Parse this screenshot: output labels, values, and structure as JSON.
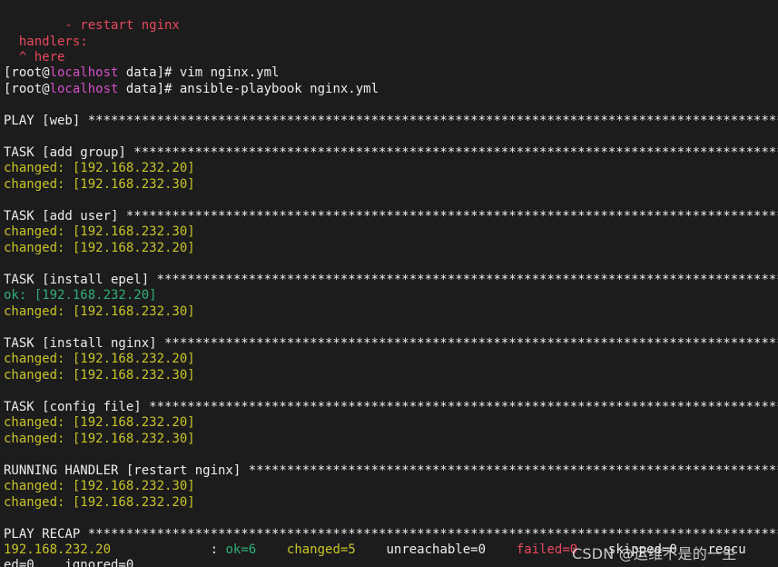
{
  "terminal": {
    "error": {
      "restart_line": "        - restart nginx",
      "handlers_line": "  handlers:",
      "here_line": "  ^ here"
    },
    "prompt": {
      "open": "[root@",
      "host": "localhost",
      "dir_close": " data]# "
    },
    "commands": [
      "vim nginx.yml",
      "ansible-playbook nginx.yml"
    ],
    "play_header": "PLAY [web] ********************************************************************************************",
    "tasks": [
      {
        "header": "TASK [add group] **************************************************************************************",
        "results": [
          {
            "status": "changed",
            "text": "changed: [192.168.232.20]"
          },
          {
            "status": "changed",
            "text": "changed: [192.168.232.30]"
          }
        ]
      },
      {
        "header": "TASK [add user] ***************************************************************************************",
        "results": [
          {
            "status": "changed",
            "text": "changed: [192.168.232.30]"
          },
          {
            "status": "changed",
            "text": "changed: [192.168.232.20]"
          }
        ]
      },
      {
        "header": "TASK [install epel] ***********************************************************************************",
        "results": [
          {
            "status": "ok",
            "text": "ok: [192.168.232.20]"
          },
          {
            "status": "changed",
            "text": "changed: [192.168.232.30]"
          }
        ]
      },
      {
        "header": "TASK [install nginx] **********************************************************************************",
        "results": [
          {
            "status": "changed",
            "text": "changed: [192.168.232.20]"
          },
          {
            "status": "changed",
            "text": "changed: [192.168.232.30]"
          }
        ]
      },
      {
        "header": "TASK [config file] ************************************************************************************",
        "results": [
          {
            "status": "changed",
            "text": "changed: [192.168.232.20]"
          },
          {
            "status": "changed",
            "text": "changed: [192.168.232.30]"
          }
        ]
      },
      {
        "header": "RUNNING HANDLER [restart nginx] ***********************************************************************",
        "results": [
          {
            "status": "changed",
            "text": "changed: [192.168.232.30]"
          },
          {
            "status": "changed",
            "text": "changed: [192.168.232.20]"
          }
        ]
      }
    ],
    "recap": {
      "header": "PLAY RECAP ********************************************************************************************",
      "host": "192.168.232.20",
      "sep": "             : ",
      "ok": "ok=6",
      "changed": "changed=5",
      "unreachable": "unreachable=0",
      "failed": "failed=0",
      "skipped_partial": "skipped=0    rescu",
      "wrap_line": "ed=0    ignored=0"
    },
    "watermark": "CSDN @运维不是的一生"
  },
  "colors": {
    "background": "#1c1c1c",
    "error_red": "#e8485e",
    "host_magenta": "#d24ec6",
    "changed_yellow": "#c7c424",
    "ok_green": "#2fae78"
  }
}
